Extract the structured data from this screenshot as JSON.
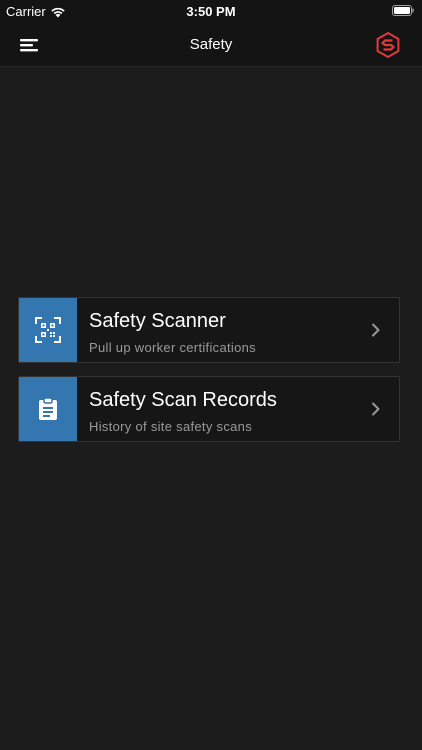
{
  "status_bar": {
    "carrier": "Carrier",
    "time": "3:50 PM",
    "wifi_icon": "wifi-icon",
    "battery_icon": "battery-icon"
  },
  "nav": {
    "title": "Safety",
    "menu_icon": "hamburger-menu-icon",
    "logo_icon": "brand-logo-icon",
    "logo_color": "#e0393e"
  },
  "cards": [
    {
      "title": "Safety Scanner",
      "subtitle": "Pull up worker certifications",
      "icon": "qr-scan-icon"
    },
    {
      "title": "Safety Scan Records",
      "subtitle": "History of site safety scans",
      "icon": "clipboard-icon"
    }
  ],
  "colors": {
    "background": "#1c1c1c",
    "accent": "#3476b0",
    "subtitle": "#9a9a9a"
  }
}
